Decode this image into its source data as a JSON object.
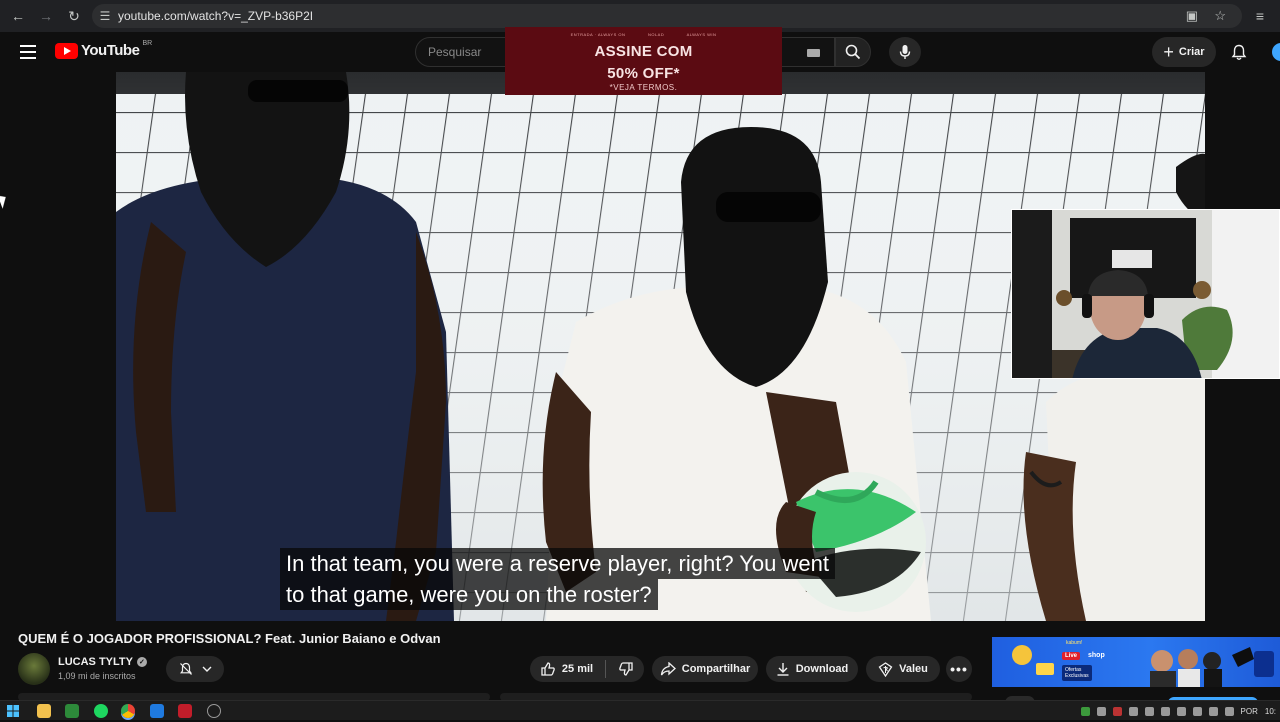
{
  "browser": {
    "url": "youtube.com/watch?v=_ZVP-b36P2I"
  },
  "header": {
    "logo_text": "YouTube",
    "country_code": "BR",
    "search_placeholder": "Pesquisar",
    "create_label": "Criar"
  },
  "ad_banner": {
    "fine_print": [
      "ENTRADA · ALWAYS ON",
      "NOLAD",
      "ALWAYS WIN"
    ],
    "headline_1": "ASSINE COM",
    "headline_2": "50% OFF*",
    "subline": "*VEJA TERMOS."
  },
  "video": {
    "subtitle_line_1": "In that team, you were a reserve player, right?  You went",
    "subtitle_line_2": "to that game, were you on the roster?"
  },
  "video_info": {
    "title": "QUEM É O JOGADOR PROFISSIONAL? Feat. Junior Baiano e Odvan",
    "channel_name": "LUCAS TYLTY",
    "subscribers": "1,09 mi de inscritos",
    "likes": "25 mil",
    "share_label": "Compartilhar",
    "download_label": "Download",
    "thanks_label": "Valeu"
  },
  "rec_ad": {
    "brand": "kabum!",
    "live_label": "Live",
    "shop_label": "shop",
    "ofertas_label": "Ofertas Exclusivas"
  },
  "taskbar": {
    "language": "POR",
    "time": "10:"
  },
  "colors": {
    "youtube_red": "#ff0000",
    "page_bg": "#0f0f0f",
    "ad_bg": "#5b0b12",
    "rec_ad_bg": "#2b78f0"
  }
}
